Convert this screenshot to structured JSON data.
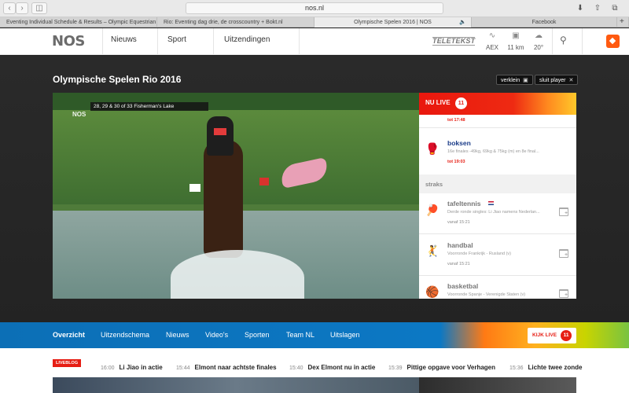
{
  "browser": {
    "url": "nos.nl",
    "tabs": [
      {
        "label": "Eventing Individual Schedule & Results – Olympic Equestrian",
        "active": false
      },
      {
        "label": "Rio: Eventing dag drie, de crosscountry + Bokt.nl",
        "active": false
      },
      {
        "label": "Olympische Spelen 2016 | NOS",
        "active": true
      },
      {
        "label": "Facebook",
        "active": false
      }
    ]
  },
  "header": {
    "logo": "NOS",
    "nav": [
      "Nieuws",
      "Sport",
      "Uitzendingen"
    ],
    "teletekst": "TELETEKST",
    "widgets": [
      {
        "icon": "chart-icon",
        "label": "AEX"
      },
      {
        "icon": "car-icon",
        "label": "11 km"
      },
      {
        "icon": "weather-icon",
        "label": "20°"
      }
    ]
  },
  "player": {
    "title": "Olympische Spelen Rio 2016",
    "verklein": "verklein",
    "sluit": "sluit player",
    "overlay_text": "28, 29 & 30 of 33   Fisherman's Lake",
    "watermark": "NOS"
  },
  "live": {
    "label": "NU LIVE",
    "count": "11",
    "items": [
      {
        "time": "tot 17:48"
      },
      {
        "sport": "boksen",
        "desc": "16e finales -49kg, 69kg & 75kg (m) en 8e final...",
        "time": "tot 19:03",
        "icon": "boxing-icon"
      }
    ],
    "straks_label": "straks",
    "upcoming": [
      {
        "sport": "tafeltennis",
        "desc": "Derde ronde singles: Li Jiao namens Nederlan...",
        "when": "vanaf 15:21",
        "icon": "table-tennis-icon"
      },
      {
        "sport": "handbal",
        "desc": "Voorronde Frankrijk - Rusland (v)",
        "when": "vanaf 15:21",
        "icon": "handball-icon"
      },
      {
        "sport": "basketbal",
        "desc": "Voorronde Spanje - Verenigde Staten (v)",
        "when": "vanaf 15:21",
        "icon": "basketball-icon"
      }
    ]
  },
  "subnav": {
    "items": [
      "Overzicht",
      "Uitzendschema",
      "Nieuws",
      "Video's",
      "Sporten",
      "Team NL",
      "Uitslagen"
    ],
    "active": "Overzicht",
    "kijk_live": "KIJK LIVE",
    "kijk_live_count": "11"
  },
  "ticker": {
    "badge": "LIVEBLOG",
    "items": [
      {
        "time": "16:00",
        "text": "Li Jiao in actie"
      },
      {
        "time": "15:44",
        "text": "Elmont naar achtste finales"
      },
      {
        "time": "15:40",
        "text": "Dex Elmont nu in actie"
      },
      {
        "time": "15:39",
        "text": "Pittige opgave voor Verhagen"
      },
      {
        "time": "15:36",
        "text": "Lichte twee zonde"
      }
    ]
  },
  "colors": {
    "nos_red": "#e61e14",
    "sport_blue": "#1b3c88",
    "subnav_blue": "#0c78c4"
  }
}
